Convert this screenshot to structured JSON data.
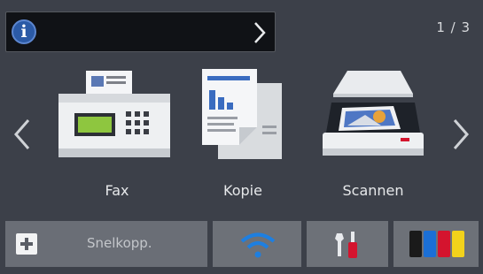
{
  "header": {
    "info_badge": "i",
    "page_indicator": "1 / 3"
  },
  "tiles": [
    {
      "label": "Fax",
      "icon": "fax-machine-icon"
    },
    {
      "label": "Kopie",
      "icon": "copy-document-icon"
    },
    {
      "label": "Scannen",
      "icon": "scanner-icon"
    }
  ],
  "bottom_bar": {
    "shortcut_label": "Snelkopp.",
    "wifi_icon": "wifi-icon",
    "settings_icon": "tools-icon",
    "ink_icon": "ink-cartridges-icon"
  },
  "colors": {
    "background": "#3c4049",
    "info_badge": "#2b5aa6",
    "wifi": "#1e7fe0",
    "ink_black": "#1a1a1a",
    "ink_cyan": "#1b6fd6",
    "ink_magenta": "#d4142e",
    "ink_yellow": "#f2d21b"
  }
}
